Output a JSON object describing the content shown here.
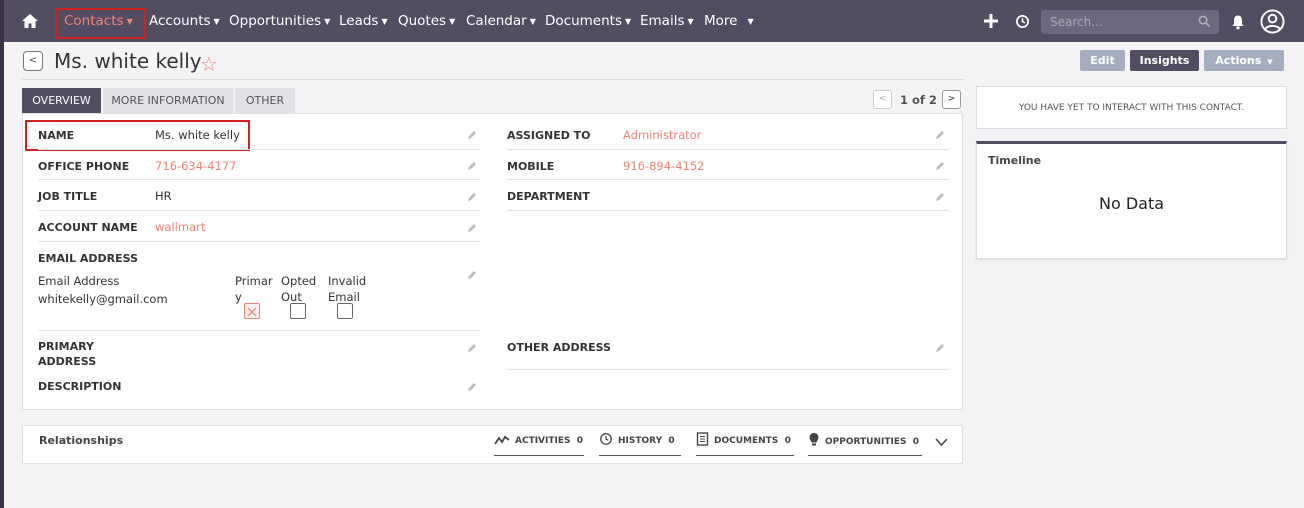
{
  "nav": {
    "items": [
      {
        "label": "Contacts",
        "active": true
      },
      {
        "label": "Accounts"
      },
      {
        "label": "Opportunities"
      },
      {
        "label": "Leads"
      },
      {
        "label": "Quotes"
      },
      {
        "label": "Calendar"
      },
      {
        "label": "Documents"
      },
      {
        "label": "Emails"
      },
      {
        "label": "More"
      }
    ],
    "search_placeholder": "Search...",
    "icons": [
      "home-icon",
      "plus-icon",
      "history-icon",
      "search-icon",
      "bell-icon",
      "user-icon"
    ]
  },
  "record": {
    "title": "Ms. white kelly",
    "buttons": {
      "edit": "Edit",
      "insights": "Insights",
      "actions": "Actions"
    }
  },
  "tabs": [
    "OVERVIEW",
    "MORE INFORMATION",
    "OTHER"
  ],
  "pager": "1 of 2",
  "fields": {
    "name_label": "NAME",
    "name_value": "Ms. white kelly",
    "assigned_label": "ASSIGNED TO",
    "assigned_value": "Administrator",
    "office_phone_label": "OFFICE PHONE",
    "office_phone_value": "716-634-4177",
    "mobile_label": "MOBILE",
    "mobile_value": "916-894-4152",
    "job_title_label": "JOB TITLE",
    "job_title_value": "HR",
    "department_label": "DEPARTMENT",
    "account_label": "ACCOUNT NAME",
    "account_value": "wallmart",
    "email_label": "EMAIL ADDRESS",
    "email_sub_label": "Email Address",
    "email_value": "whitekelly@gmail.com",
    "primary_1": "Primar",
    "primary_2": "y",
    "opted_1": "Opted",
    "opted_2": "Out",
    "invalid_1": "Invalid",
    "invalid_2": "Email",
    "primary_address_1": "PRIMARY",
    "primary_address_2": "ADDRESS",
    "other_address_label": "OTHER ADDRESS",
    "description_label": "DESCRIPTION"
  },
  "interactions": {
    "text": "YOU HAVE YET TO INTERACT WITH THIS CONTACT."
  },
  "timeline": {
    "title": "Timeline",
    "empty": "No Data"
  },
  "relationships": {
    "title": "Relationships",
    "items": [
      {
        "label": "ACTIVITIES",
        "count": "0"
      },
      {
        "label": "HISTORY",
        "count": "0"
      },
      {
        "label": "DOCUMENTS",
        "count": "0"
      },
      {
        "label": "OPPORTUNITIES",
        "count": "0"
      }
    ]
  },
  "colors": {
    "nav_bg": "#534d64",
    "accent": "#f08377",
    "highlight": "#d0221f"
  }
}
